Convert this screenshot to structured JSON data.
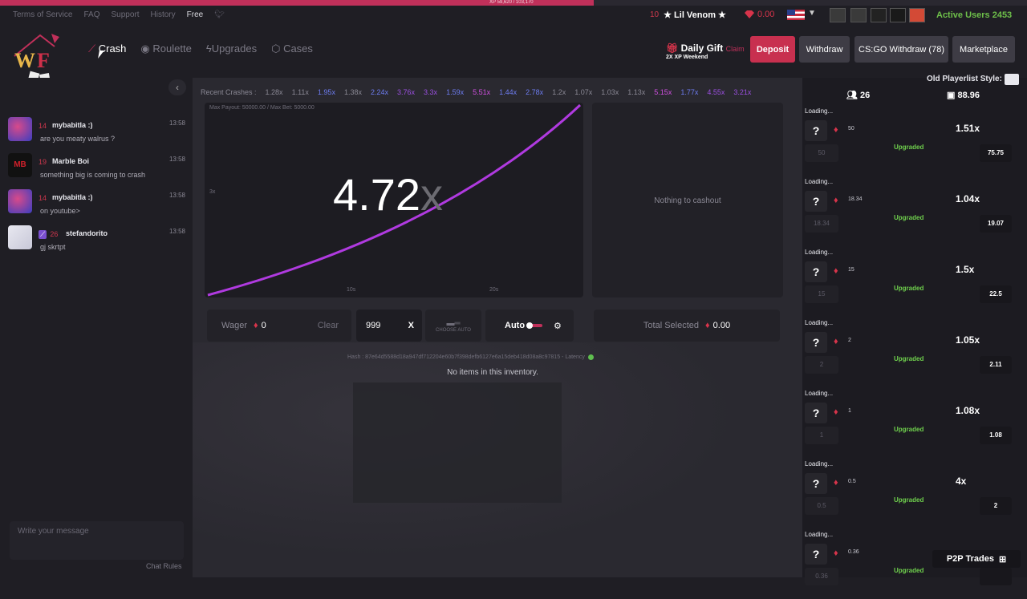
{
  "xp": {
    "text": "XP 59,620 / 103,170",
    "progress": 0.578
  },
  "top_links": [
    "Terms of Service",
    "FAQ",
    "Support",
    "History",
    "Free"
  ],
  "user": {
    "level": "10",
    "name": "★ Lil Venom ★",
    "balance": "0.00"
  },
  "active_users": "Active Users 2453",
  "game_nav": [
    "Crash",
    "Roulette",
    "Upgrades",
    "Cases"
  ],
  "daily_gift": {
    "label": "Daily Gift",
    "claim": "Claim",
    "sub": "2X XP Weekend"
  },
  "buttons": {
    "deposit": "Deposit",
    "withdraw": "Withdraw",
    "csgo_withdraw": "CS:GO Withdraw (78)",
    "marketplace": "Marketplace"
  },
  "chat": {
    "messages": [
      {
        "level": "14",
        "name": "mybabitla :)",
        "time": "13:58",
        "text": "are you meaty walrus ?"
      },
      {
        "level": "19",
        "name": "Marble Boi",
        "time": "13:58",
        "text": "something big is coming to crash"
      },
      {
        "level": "14",
        "name": "mybabitla :)",
        "time": "13:58",
        "text": "on youtube>"
      },
      {
        "level": "26",
        "name": "stefandorito",
        "time": "13:58",
        "text": "gj skrtpt"
      }
    ],
    "placeholder": "Write your message",
    "rules": "Chat Rules"
  },
  "recent": {
    "label": "Recent Crashes :",
    "values": [
      {
        "v": "1.28x",
        "c": "#8a8894"
      },
      {
        "v": "1.11x",
        "c": "#8a8894"
      },
      {
        "v": "1.95x",
        "c": "#6d7cf0"
      },
      {
        "v": "1.38x",
        "c": "#8a8894"
      },
      {
        "v": "2.24x",
        "c": "#6d7cf0"
      },
      {
        "v": "3.76x",
        "c": "#9b4fe0"
      },
      {
        "v": "3.3x",
        "c": "#9b4fe0"
      },
      {
        "v": "1.59x",
        "c": "#6d7cf0"
      },
      {
        "v": "5.51x",
        "c": "#d04fe0"
      },
      {
        "v": "1.44x",
        "c": "#6d7cf0"
      },
      {
        "v": "2.78x",
        "c": "#6d7cf0"
      },
      {
        "v": "1.2x",
        "c": "#8a8894"
      },
      {
        "v": "1.07x",
        "c": "#8a8894"
      },
      {
        "v": "1.03x",
        "c": "#8a8894"
      },
      {
        "v": "1.13x",
        "c": "#8a8894"
      },
      {
        "v": "5.15x",
        "c": "#d04fe0"
      },
      {
        "v": "1.77x",
        "c": "#6d7cf0"
      },
      {
        "v": "4.55x",
        "c": "#9b4fe0"
      },
      {
        "v": "3.21x",
        "c": "#9b4fe0"
      }
    ]
  },
  "graph": {
    "max_payout": "Max Payout: 50000.00 / Max Bet: 5000.00",
    "y_label": "3x",
    "x10": "10s",
    "x20": "20s",
    "multiplier": "4.72",
    "suffix": "x"
  },
  "cashout_empty": "Nothing to cashout",
  "controls": {
    "wager_label": "Wager",
    "wager": "0",
    "clear": "Clear",
    "auto_value": "999",
    "x": "X",
    "choose_auto": "CHOOSE AUTO",
    "auto": "Auto",
    "total_label": "Total Selected",
    "total": "0.00"
  },
  "hash": "Hash : 87e64d5588d18a947df712204e60b7f398defb6127e6a15deb418d08a8c97815 - Latency",
  "no_items": "No items in this inventory.",
  "right": {
    "style_label": "Old Playerlist Style:",
    "players_count": "26",
    "pot": "88.96",
    "players": [
      {
        "loading": "Loading...",
        "bet": "50",
        "mult": "1.51x",
        "status": "Upgraded",
        "value": "75.75"
      },
      {
        "loading": "Loading...",
        "bet": "18.34",
        "mult": "1.04x",
        "status": "Upgraded",
        "value": "19.07"
      },
      {
        "loading": "Loading...",
        "bet": "15",
        "mult": "1.5x",
        "status": "Upgraded",
        "value": "22.5"
      },
      {
        "loading": "Loading...",
        "bet": "2",
        "mult": "1.05x",
        "status": "Upgraded",
        "value": "2.11"
      },
      {
        "loading": "Loading...",
        "bet": "1",
        "mult": "1.08x",
        "status": "Upgraded",
        "value": "1.08"
      },
      {
        "loading": "Loading...",
        "bet": "0.5",
        "mult": "4x",
        "status": "Upgraded",
        "value": "2"
      },
      {
        "loading": "Loading...",
        "bet": "0.36",
        "mult": "",
        "status": "Upgraded",
        "value": ""
      }
    ]
  },
  "p2p": "P2P Trades"
}
